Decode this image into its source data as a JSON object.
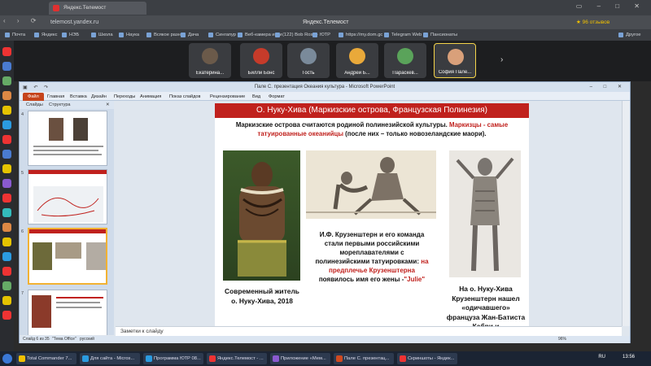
{
  "browser": {
    "tabs": [
      {
        "label": "Яндекс.Телемост",
        "active": true
      }
    ],
    "url": "telemost.yandex.ru",
    "window_title": "Яндекс.Телемост",
    "rating": "★ 96 отзывов",
    "bookmarks": [
      "Почта",
      "Яндекс",
      "НЭБ",
      "Школа",
      "Наука",
      "Всякое разное",
      "Дача",
      "Сингапур",
      "Веб-камера и ми",
      "(122) Bob Ross - ",
      "ЮТР",
      "https://my.dom.gc",
      "Telegram Web",
      "Пансионаты",
      "Другое"
    ]
  },
  "participants": [
    {
      "name": "Екатерина...",
      "color": "#6b5a4a"
    },
    {
      "name": "Билли Бонс",
      "color": "#c63b2a"
    },
    {
      "name": "Гость",
      "color": "#7a8a9a"
    },
    {
      "name": "Андрей Б...",
      "color": "#e9a93a"
    },
    {
      "name": "Параскев...",
      "color": "#5aa35a"
    },
    {
      "name": "София Пале...",
      "color": "#d9a07a",
      "active": true
    }
  ],
  "ppt": {
    "title": "Пале С. презентация Океания культура - Microsoft PowerPoint",
    "ribbon_tabs": [
      "Файл",
      "Главная",
      "Вставка",
      "Дизайн",
      "Переходы",
      "Анимация",
      "Показ слайдов",
      "Рецензирование",
      "Вид",
      "Формат"
    ],
    "panel_tabs": [
      "Слайды",
      "Структура"
    ],
    "thumb_numbers": [
      "4",
      "5",
      "6",
      "7"
    ],
    "notes_placeholder": "Заметки к слайду",
    "status": {
      "slide": "Слайд 6 из 35",
      "theme": "\"Тема Office\"",
      "lang": "русский",
      "zoom": "96%"
    }
  },
  "slide": {
    "title": "О. Нуку-Хива (Маркизские острова, Французская Полинезия)",
    "intro_black1": "Маркизские острова считаются родиной полинезийской культуры. ",
    "intro_red": "Маркизцы - самые татуированные океанийцы",
    "intro_black2": " (после них – только новозеландские маори).",
    "caption_left": "Современный житель о. Нуку-Хива, 2018",
    "caption_mid_black": "И.Ф. Крузенштерн и его команда стали первыми российскими мореплавателями с полинезийскими татуировками: ",
    "caption_mid_red": "на предплечье Крузенштерна",
    "caption_mid_black2": " появилось имя его жены -",
    "caption_mid_red2": "\"Julie\"",
    "caption_right": "На о. Нуку-Хива Крузенштерн нашел «одичавшего» француза Жан-Батиста Кабри и"
  },
  "taskbar": {
    "items": [
      "Total Commander 7...",
      "Для сайта - Micros...",
      "Программа ЮТР 08...",
      "Яндекс.Телемост - ...",
      "Приложение «Мем...",
      "Пале С. презентац...",
      "Скриншоты - Яндек..."
    ],
    "lang": "RU",
    "time": "13:56"
  }
}
